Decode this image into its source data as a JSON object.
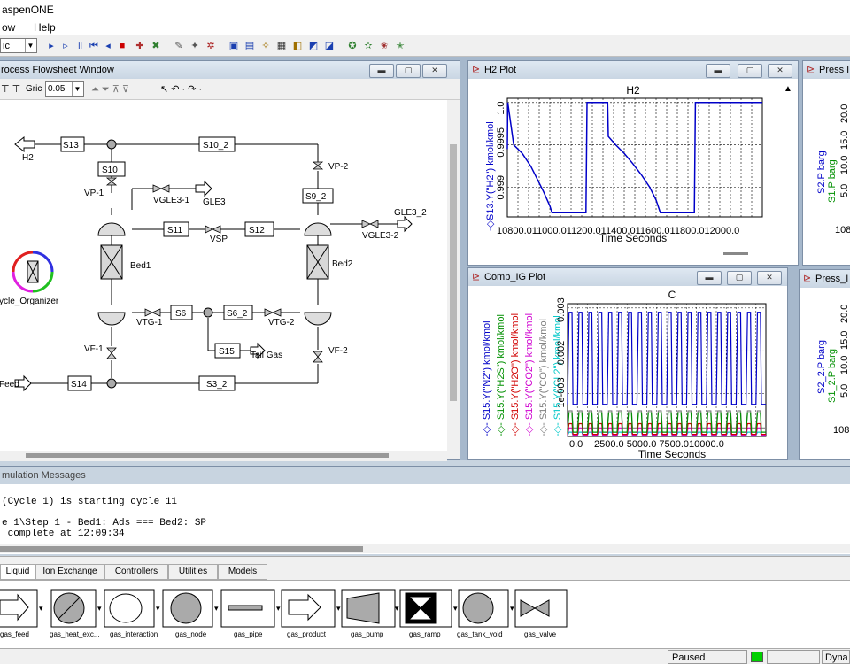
{
  "app": {
    "title": "aspenONE"
  },
  "menu": {
    "items": [
      "ow",
      "Help"
    ]
  },
  "toolbar": {
    "combo_value": "ic"
  },
  "flowsheet": {
    "title": "rocess Flowsheet Window",
    "grid_label": "Gric",
    "grid_value": "0.05",
    "streams": [
      "S13",
      "S10",
      "S10_2",
      "S9_2",
      "S11",
      "S12",
      "S6",
      "S6_2",
      "S15",
      "S14",
      "S3_2"
    ],
    "labels": {
      "h2": "H2",
      "vp1": "VP-1",
      "vgle31": "VGLE3-1",
      "gle3": "GLE3",
      "vp2": "VP-2",
      "gle32": "GLE3_2",
      "vgle32": "VGLE3-2",
      "vsp": "VSP",
      "bed1": "Bed1",
      "bed2": "Bed2",
      "vtg1": "VTG-1",
      "vtg2": "VTG-2",
      "tailgas": "Tail Gas",
      "vf1": "VF-1",
      "vf2": "VF-2",
      "feed": "Feed",
      "cycle": "ycle_Organizer"
    }
  },
  "h2_plot": {
    "title": "H2 Plot"
  },
  "comp_plot": {
    "title": "Comp_IG Plot"
  },
  "press_plot_1": {
    "title": "Press I"
  },
  "press_plot_2": {
    "title": "Press_I"
  },
  "chart_data": [
    {
      "type": "line",
      "title": "H2",
      "xlabel": "Time Seconds",
      "ylabel": "S13.Y(\"H2\") kmol/kmol",
      "x_ticks": [
        "10800.0",
        "11000.0",
        "11200.0",
        "11400.0",
        "11600.0",
        "11800.0",
        "12000.0"
      ],
      "x_tick_text": "10800.011000.011200.011400.011600.011800.012000.0",
      "y_ticks": [
        "0.999",
        "0.9995",
        "1.0"
      ],
      "xlim": [
        10800,
        12000
      ],
      "ylim": [
        0.99865,
        1.00005
      ],
      "grid": true,
      "series": [
        {
          "name": "S13.Y(\"H2\") kmol/kmol",
          "color": "#0000c8",
          "x": [
            10800,
            10802,
            10830,
            10870,
            10910,
            10940,
            10970,
            11000,
            11010,
            11170,
            11175,
            11272,
            11275,
            11310,
            11350,
            11390,
            11430,
            11470,
            11500,
            11520,
            11680,
            11685,
            11780,
            11785,
            12000
          ],
          "y": [
            0.99945,
            1.0,
            0.9995,
            0.9994,
            0.99925,
            0.9991,
            0.99895,
            0.99878,
            0.9987,
            0.9987,
            1.0,
            1.0,
            0.9996,
            0.9995,
            0.9994,
            0.99928,
            0.99915,
            0.999,
            0.99885,
            0.9987,
            0.9987,
            1.0,
            1.0,
            1.0,
            1.0
          ]
        }
      ]
    },
    {
      "type": "line",
      "title": "C",
      "xlabel": "Time Seconds",
      "x_ticks": [
        "0.0",
        "2500.0",
        "5000.0",
        "7500.0",
        "10000.0"
      ],
      "x_tick_text": [
        "0.0",
        "2500.0 5000.0 7500.010000.0"
      ],
      "y_ticks": [
        "1e-003",
        "0.002",
        "0.003"
      ],
      "xlim": [
        0,
        12000
      ],
      "ylim": [
        0,
        0.0031
      ],
      "grid": true,
      "series": [
        {
          "name": "S15.Y(\"N2\") kmol/kmol",
          "color": "#0000c8",
          "peak": 0.0029,
          "base": 0.00075,
          "cycles": 20
        },
        {
          "name": "S15.Y(\"H2S\") kmol/kmol",
          "color": "#009000",
          "peak": 0.00055,
          "base": 0.0001,
          "cycles": 20
        },
        {
          "name": "S15.Y(\"H2O\") kmol/kmol",
          "color": "#d00000",
          "peak": 0.0003,
          "base": 5e-05,
          "cycles": 20
        },
        {
          "name": "S15.Y(\"CO2\") kmol/kmol",
          "color": "#d000d0",
          "peak": 0.0002,
          "base": 3e-05,
          "cycles": 20
        },
        {
          "name": "S15.Y(\"CO\") kmol/kmol",
          "color": "#808080",
          "peak": 0.0006,
          "base": 0.0002,
          "cycles": 20
        },
        {
          "name": "S15.Y(\"CL2\") kmol/kmol",
          "color": "#00c8c8",
          "peak": 0.0001,
          "base": 2e-05,
          "cycles": 20
        }
      ]
    },
    {
      "type": "line",
      "ylabel_series": [
        "S2.P barg",
        "S1.P barg"
      ],
      "y_ticks": [
        "5.0",
        "10.0",
        "15.0",
        "20.0"
      ],
      "x_tick_partial": "108"
    },
    {
      "type": "line",
      "ylabel_series": [
        "S2_2.P barg",
        "S1_2.P barg"
      ],
      "y_ticks": [
        "5.0",
        "10.0",
        "15.0",
        "20.0"
      ],
      "x_tick_partial": "108"
    }
  ],
  "messages": {
    "title": "mulation Messages",
    "lines": [
      "(Cycle 1) is starting cycle 11",
      "",
      "e 1\\Step 1 - Bed1: Ads === Bed2: SP",
      " complete at 12:09:34"
    ]
  },
  "library": {
    "tabs": [
      "Liquid",
      "Ion Exchange",
      "Controllers",
      "Utilities",
      "Models"
    ],
    "items": [
      "gas_feed",
      "gas_heat_exc...",
      "gas_interaction",
      "gas_node",
      "gas_pipe",
      "gas_product",
      "gas_pump",
      "gas_ramp",
      "gas_tank_void",
      "gas_valve"
    ]
  },
  "status": {
    "state": "Paused",
    "mode": "Dyna"
  }
}
